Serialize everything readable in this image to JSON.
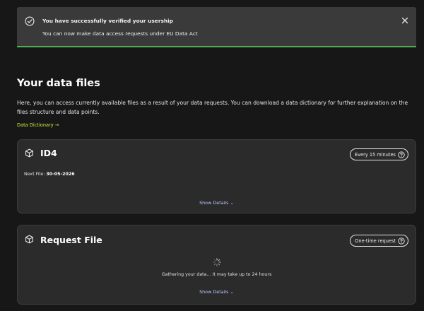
{
  "banner": {
    "title": "You have successfully verified your usership",
    "message": "You can now make data access requests under EU Data Act",
    "accent_color": "#4caf50"
  },
  "section": {
    "title": "Your data files",
    "description": "Here, you can access currently available files as a result of your data requests. You can download a data dictionary for further explanation on the files structure and data points.",
    "dictionary_link": "Data Dictionary →",
    "link_color": "#d6ee3c"
  },
  "cards": [
    {
      "title": "ID4",
      "icon": "cube-icon",
      "frequency": "Every 15 minutes",
      "next_file_label": "Next File:",
      "next_file_date": "30-05-2026",
      "show_details": "Show Details ⌄"
    },
    {
      "title": "Request File",
      "icon": "cube-icon",
      "frequency": "One-time request",
      "status": "Gathering your data... It may take up to 24 hours",
      "show_details": "Show Details ⌄"
    }
  ]
}
